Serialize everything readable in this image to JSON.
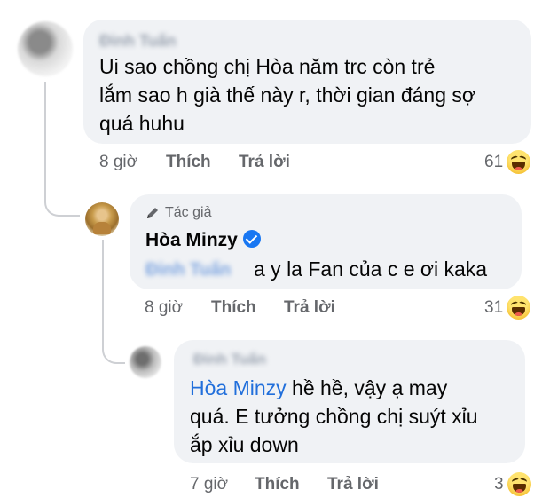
{
  "comment1": {
    "author": "Đinh Tuấn",
    "lines": [
      "Ui sao chồng chị Hòa năm trc còn trẻ",
      "lắm sao h già thế này r, thời gian đáng sợ",
      "quá huhu"
    ],
    "time": "8 giờ",
    "like_label": "Thích",
    "reply_label": "Trả lời",
    "reaction_count": "61",
    "reaction_icon": "haha-icon"
  },
  "reply1": {
    "badge": "Tác giả",
    "badge_icon": "pen-icon",
    "author": "Hòa Minzy",
    "verified_icon": "verified-badge-icon",
    "mention": "Đinh Tuấn",
    "text": "a y la Fan của c e ơi kaka",
    "time": "8 giờ",
    "like_label": "Thích",
    "reply_label": "Trả lời",
    "reaction_count": "31",
    "reaction_icon": "haha-icon"
  },
  "reply2": {
    "author": "Đinh Tuấn",
    "mention": "Hòa Minzy",
    "line1_rest": " hề hề, vậy ạ may",
    "line2": "quá. E tưởng chồng chị suýt xỉu",
    "line3": "ắp xỉu down",
    "time": "7 giờ",
    "like_label": "Thích",
    "reply_label": "Trả lời",
    "reaction_count": "3",
    "reaction_icon": "haha-icon"
  },
  "colors": {
    "bubble_bg": "#f0f2f5",
    "mention_blue": "#216fdb",
    "meta_gray": "#65676b",
    "verified_blue": "#1877f2"
  }
}
